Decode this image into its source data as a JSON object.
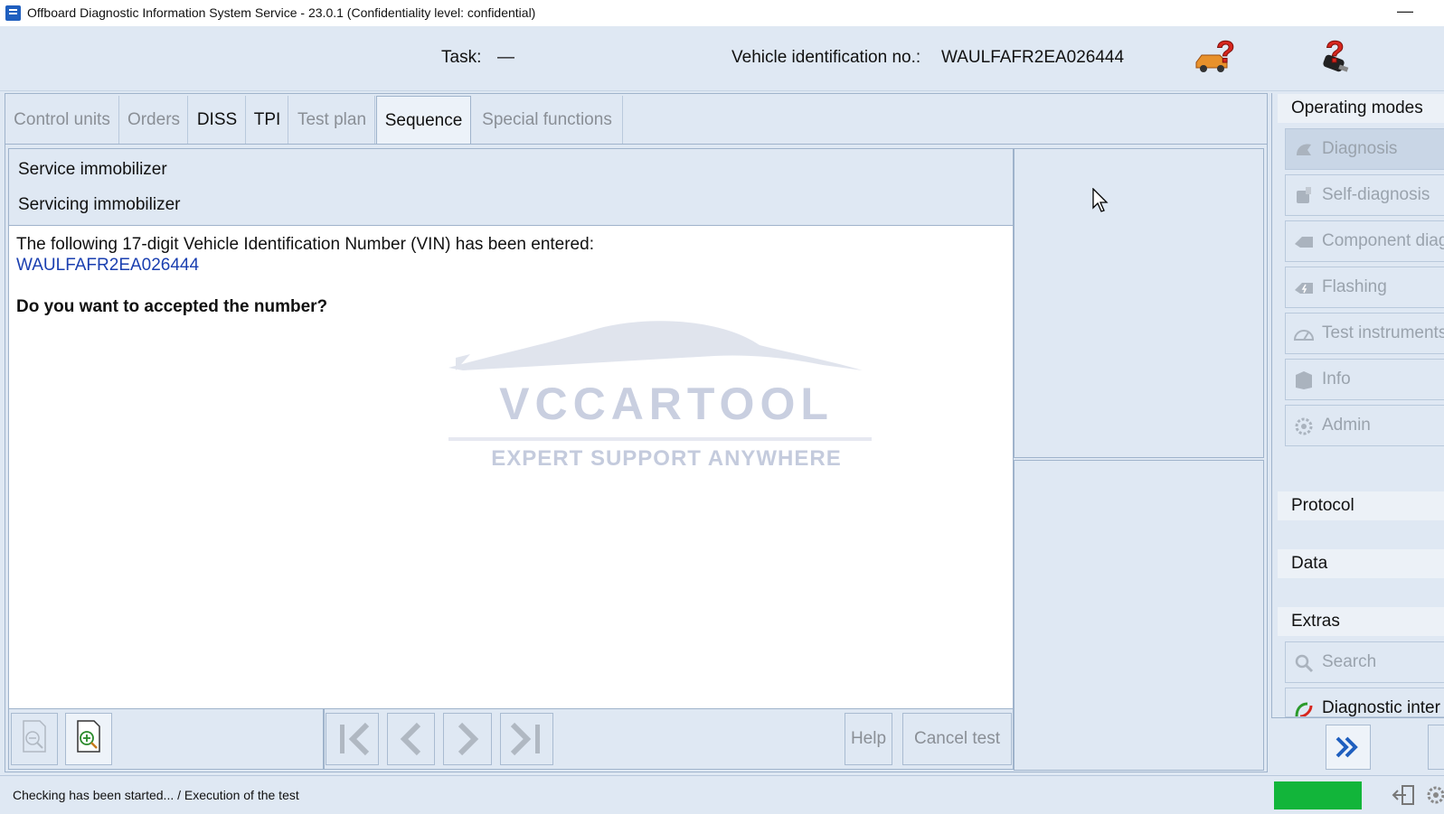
{
  "window": {
    "title": "Offboard Diagnostic Information System Service - 23.0.1 (Confidentiality level: confidential)",
    "minimize": "—"
  },
  "header": {
    "task_label": "Task:",
    "task_value": "—",
    "vin_label": "Vehicle identification no.:",
    "vin_value": "WAULFAFR2EA026444"
  },
  "tabs": [
    {
      "label": "Control units",
      "state": "disabled"
    },
    {
      "label": "Orders",
      "state": "disabled"
    },
    {
      "label": "DISS",
      "state": "enabled"
    },
    {
      "label": "TPI",
      "state": "enabled"
    },
    {
      "label": "Test plan",
      "state": "disabled"
    },
    {
      "label": "Sequence",
      "state": "selected"
    },
    {
      "label": "Special functions",
      "state": "disabled"
    }
  ],
  "sequence": {
    "title": "Service immobilizer",
    "subtitle": "Servicing immobilizer"
  },
  "content": {
    "message": "The following 17-digit Vehicle Identification Number (VIN) has been entered:",
    "vin": "WAULFAFR2EA026444",
    "question": "Do you want to accepted the number?"
  },
  "watermark": {
    "title": "VCCARTOOL",
    "slogan": "EXPERT SUPPORT ANYWHERE"
  },
  "toolbar": {
    "help": "Help",
    "cancel": "Cancel test"
  },
  "status": {
    "text": "Checking has been started... / Execution of the test",
    "indicator_color": "#12b53a"
  },
  "right_panel": {
    "operating_modes_title": "Operating modes",
    "modes": [
      {
        "label": "Diagnosis",
        "icon": "diagnosis-icon"
      },
      {
        "label": "Self-diagnosis",
        "icon": "self-diagnosis-icon"
      },
      {
        "label": "Component diag",
        "icon": "component-icon"
      },
      {
        "label": "Flashing",
        "icon": "flashing-icon"
      },
      {
        "label": "Test instruments",
        "icon": "test-instruments-icon"
      },
      {
        "label": "Info",
        "icon": "info-icon"
      },
      {
        "label": "Admin",
        "icon": "admin-icon"
      }
    ],
    "protocol_title": "Protocol",
    "data_title": "Data",
    "extras_title": "Extras",
    "extras": [
      {
        "label": "Search",
        "icon": "search-icon"
      },
      {
        "label": "Diagnostic inter",
        "icon": "diagnostic-interface-icon"
      }
    ]
  },
  "colors": {
    "background": "#dfe8f3",
    "border": "#9fb3cb",
    "vin_link": "#1a3fb0",
    "disabled_text": "#8a8f96",
    "accent_blue": "#1f5fbf"
  }
}
